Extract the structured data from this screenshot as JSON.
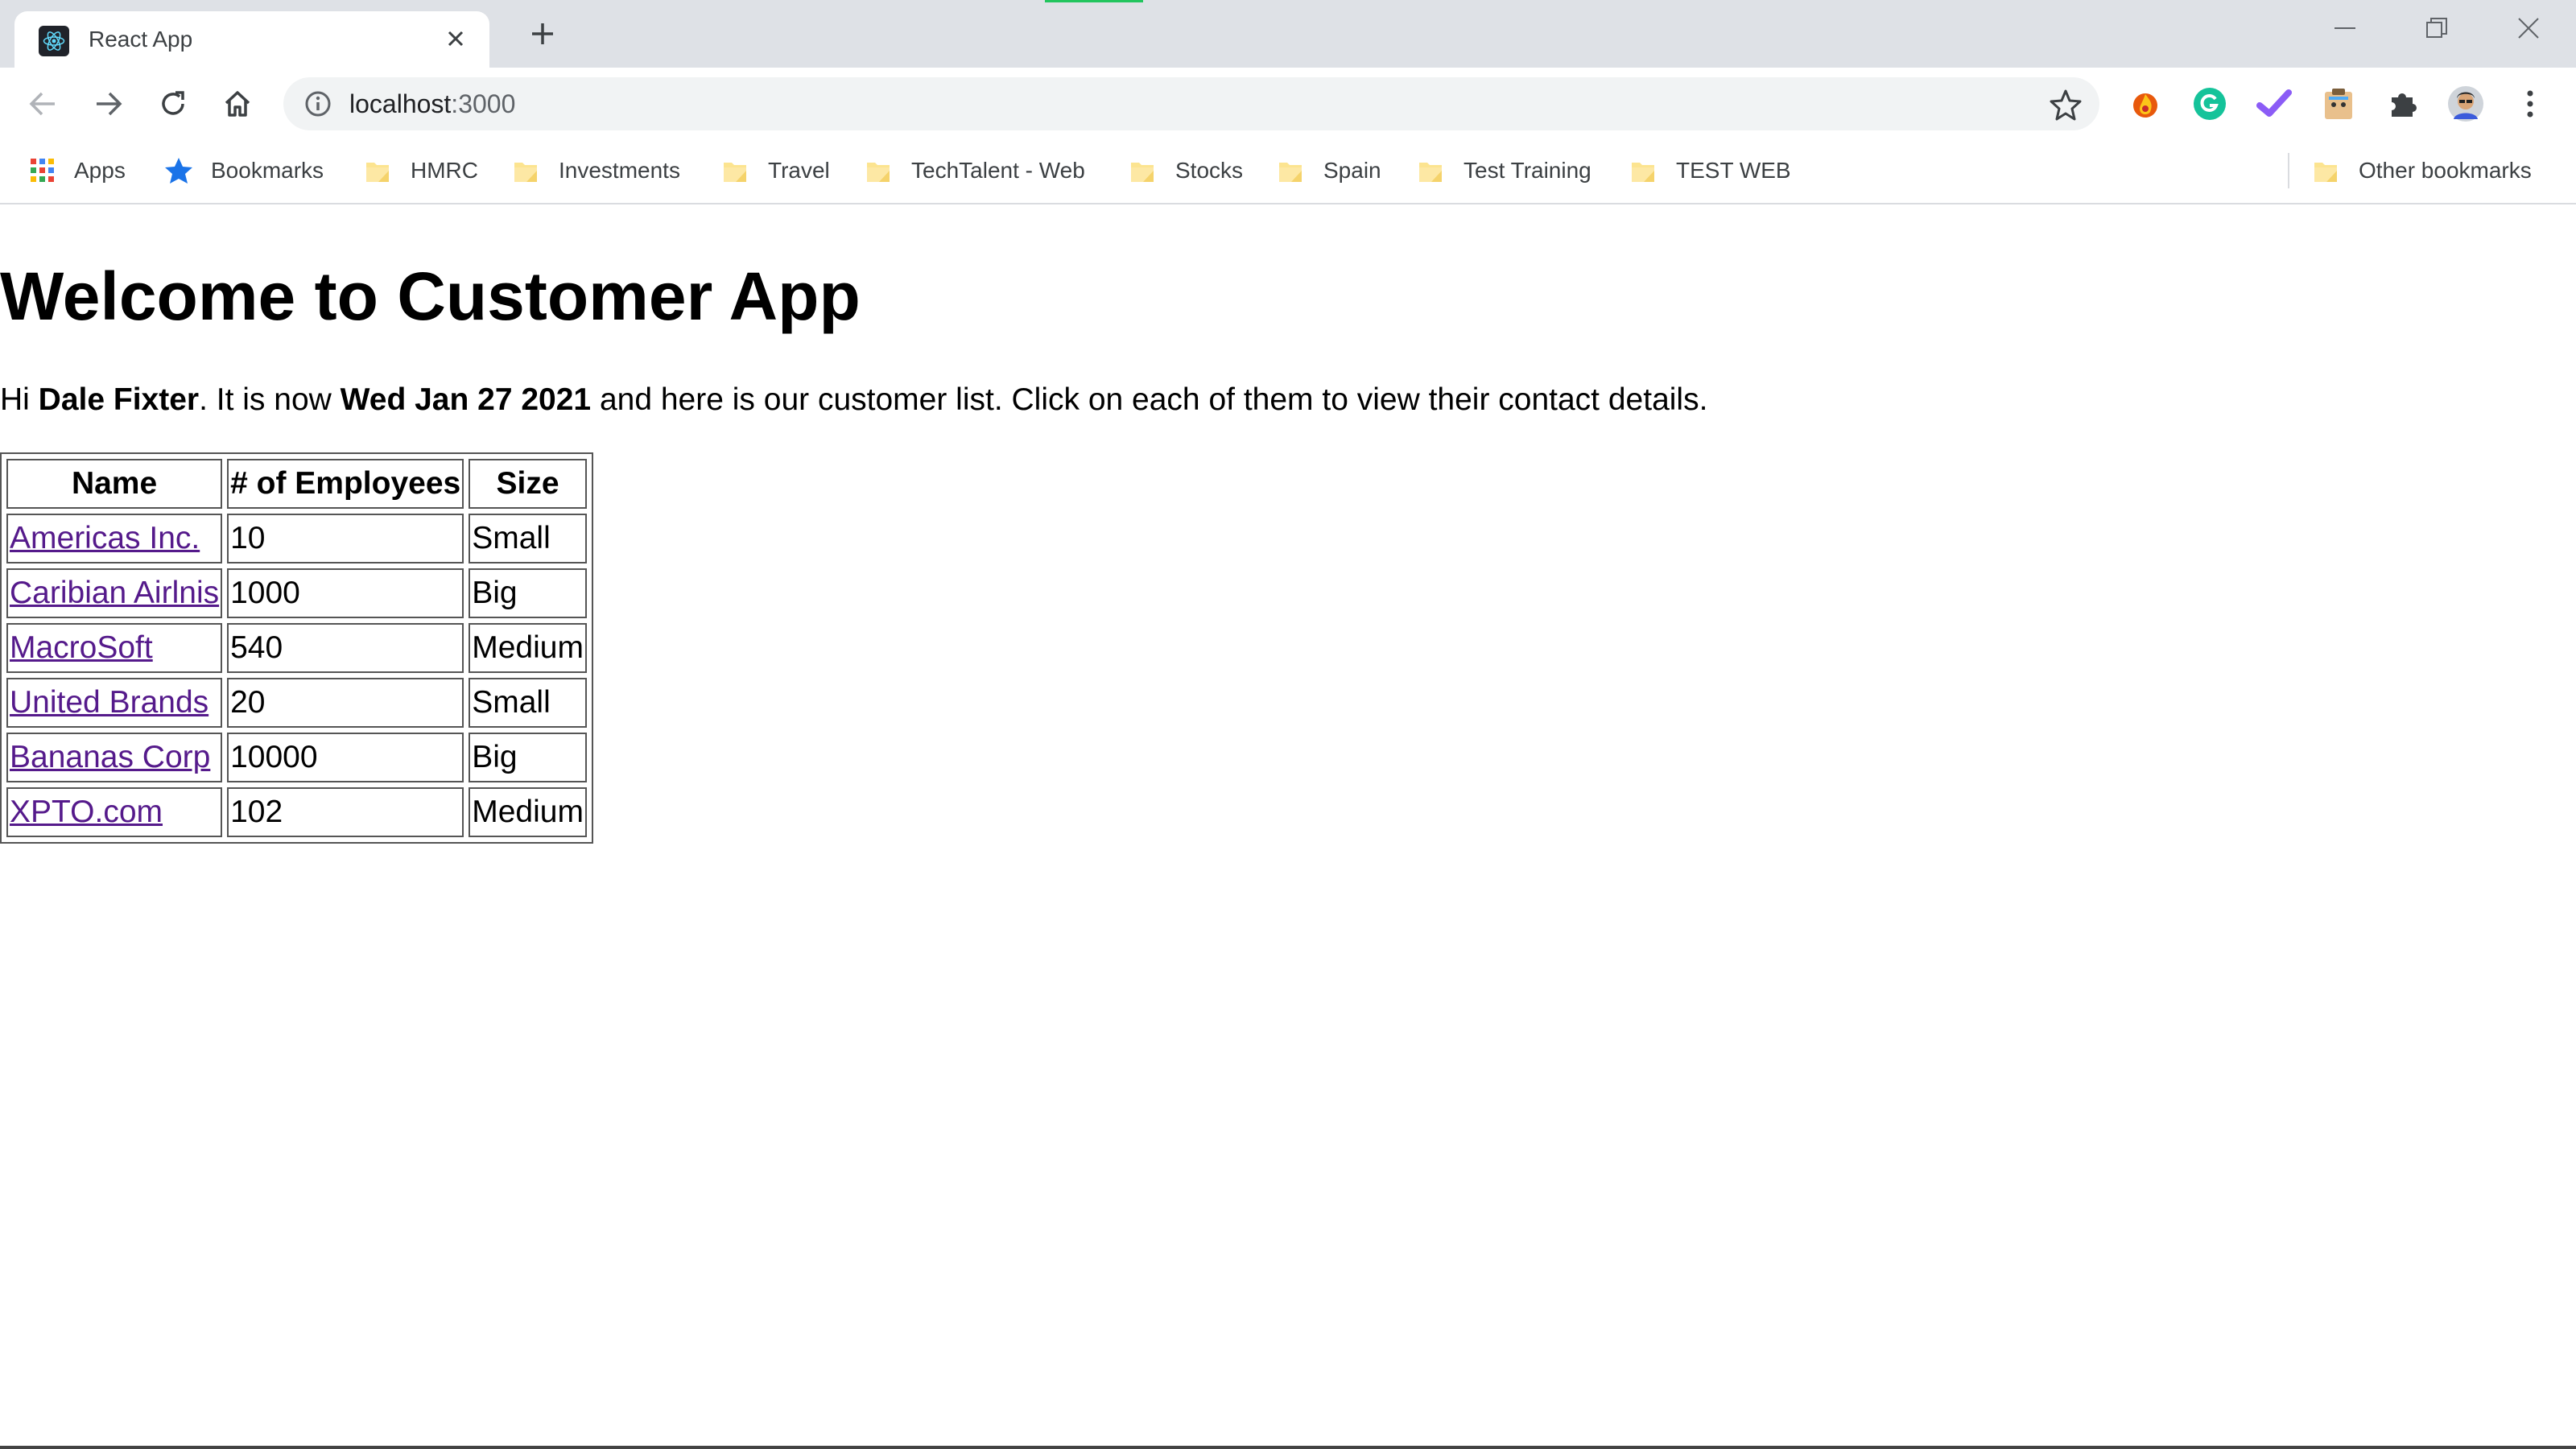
{
  "browser": {
    "tab_title": "React App",
    "url_host": "localhost",
    "url_port": ":3000",
    "new_tab_icon": "plus-icon",
    "extensions": [
      "fire-extension-icon",
      "grammarly-icon",
      "checkmark-extension-icon",
      "clipboard-extension-icon",
      "puzzle-icon",
      "avatar",
      "more-vert-icon"
    ]
  },
  "bookmarks": {
    "apps": "Apps",
    "items": [
      "Bookmarks",
      "HMRC",
      "Investments",
      "Travel",
      "TechTalent - Web",
      "Stocks",
      "Spain",
      "Test Training",
      "TEST WEB"
    ],
    "other": "Other bookmarks"
  },
  "page": {
    "heading": "Welcome to Customer App",
    "intro_prefix": "Hi ",
    "user_name": "Dale Fixter",
    "intro_mid": ". It is now ",
    "date": "Wed Jan 27 2021",
    "intro_suffix": " and here is our customer list. Click on each of them to view their contact details."
  },
  "table": {
    "headers": [
      "Name",
      "# of Employees",
      "Size"
    ],
    "rows": [
      {
        "name": "Americas Inc.",
        "employees": "10",
        "size": "Small"
      },
      {
        "name": "Caribian Airlnis",
        "employees": "1000",
        "size": "Big"
      },
      {
        "name": "MacroSoft",
        "employees": "540",
        "size": "Medium"
      },
      {
        "name": "United Brands",
        "employees": "20",
        "size": "Small"
      },
      {
        "name": "Bananas Corp",
        "employees": "10000",
        "size": "Big"
      },
      {
        "name": "XPTO.com",
        "employees": "102",
        "size": "Medium"
      }
    ]
  },
  "colors": {
    "link_visited": "#551a8b",
    "tabstrip_bg": "#dee1e6",
    "omnibox_bg": "#f1f3f4",
    "folder_yellow": "#fce490"
  }
}
